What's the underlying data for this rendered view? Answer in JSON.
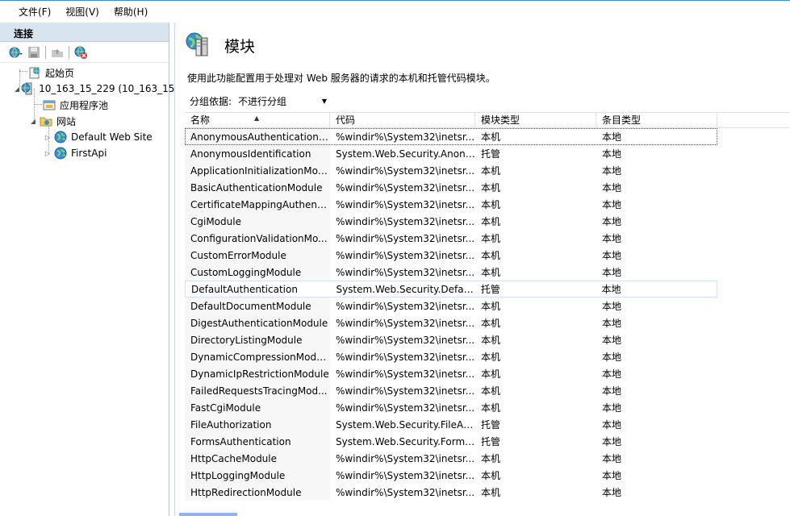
{
  "menu": [
    "文件(F)",
    "视图(V)",
    "帮助(H)"
  ],
  "connections": {
    "header": "连接",
    "tree": [
      {
        "label": "起始页",
        "icon": "start-page-icon",
        "indent": 0,
        "expander": ""
      },
      {
        "label": "10_163_15_229 (10_163_15_",
        "icon": "server-icon",
        "indent": 0,
        "expander": "◢"
      },
      {
        "label": "应用程序池",
        "icon": "app-pool-icon",
        "indent": 1,
        "expander": ""
      },
      {
        "label": "网站",
        "icon": "sites-folder-icon",
        "indent": 1,
        "expander": "◢"
      },
      {
        "label": "Default Web Site",
        "icon": "globe-icon",
        "indent": 2,
        "expander": "▷"
      },
      {
        "label": "FirstApi",
        "icon": "globe-icon",
        "indent": 2,
        "expander": "▷"
      }
    ]
  },
  "main": {
    "title": "模块",
    "description": "使用此功能配置用于处理对 Web 服务器的请求的本机和托管代码模块。",
    "groupby_label": "分组依据:",
    "groupby_value": "不进行分组",
    "columns": [
      "名称",
      "代码",
      "模块类型",
      "条目类型"
    ],
    "rows": [
      [
        "AnonymousAuthenticationM...",
        "%windir%\\System32\\inetsr...",
        "本机",
        "本地"
      ],
      [
        "AnonymousIdentification",
        "System.Web.Security.Anony...",
        "托管",
        "本地"
      ],
      [
        "ApplicationInitializationMod...",
        "%windir%\\System32\\inetsr...",
        "本机",
        "本地"
      ],
      [
        "BasicAuthenticationModule",
        "%windir%\\System32\\inetsr...",
        "本机",
        "本地"
      ],
      [
        "CertificateMappingAuthenti...",
        "%windir%\\System32\\inetsr...",
        "本机",
        "本地"
      ],
      [
        "CgiModule",
        "%windir%\\System32\\inetsr...",
        "本机",
        "本地"
      ],
      [
        "ConfigurationValidationMo...",
        "%windir%\\System32\\inetsr...",
        "本机",
        "本地"
      ],
      [
        "CustomErrorModule",
        "%windir%\\System32\\inetsr...",
        "本机",
        "本地"
      ],
      [
        "CustomLoggingModule",
        "%windir%\\System32\\inetsr...",
        "本机",
        "本地"
      ],
      [
        "DefaultAuthentication",
        "System.Web.Security.Defau...",
        "托管",
        "本地"
      ],
      [
        "DefaultDocumentModule",
        "%windir%\\System32\\inetsr...",
        "本机",
        "本地"
      ],
      [
        "DigestAuthenticationModule",
        "%windir%\\System32\\inetsr...",
        "本机",
        "本地"
      ],
      [
        "DirectoryListingModule",
        "%windir%\\System32\\inetsr...",
        "本机",
        "本地"
      ],
      [
        "DynamicCompressionModule",
        "%windir%\\System32\\inetsr...",
        "本机",
        "本地"
      ],
      [
        "DynamicIpRestrictionModule",
        "%windir%\\System32\\inetsr...",
        "本机",
        "本地"
      ],
      [
        "FailedRequestsTracingMod...",
        "%windir%\\System32\\inetsr...",
        "本机",
        "本地"
      ],
      [
        "FastCgiModule",
        "%windir%\\System32\\inetsr...",
        "本机",
        "本地"
      ],
      [
        "FileAuthorization",
        "System.Web.Security.FileAu...",
        "托管",
        "本地"
      ],
      [
        "FormsAuthentication",
        "System.Web.Security.Forms...",
        "托管",
        "本地"
      ],
      [
        "HttpCacheModule",
        "%windir%\\System32\\inetsr...",
        "本机",
        "本地"
      ],
      [
        "HttpLoggingModule",
        "%windir%\\System32\\inetsr...",
        "本机",
        "本地"
      ],
      [
        "HttpRedirectionModule",
        "%windir%\\System32\\inetsr...",
        "本机",
        "本地"
      ]
    ],
    "focused_row": 0,
    "hover_row": 9
  },
  "colors": {
    "header_bg": "#d9e4f1",
    "accent": "#3a8bd8",
    "hover_border": "#cfe3f7"
  }
}
